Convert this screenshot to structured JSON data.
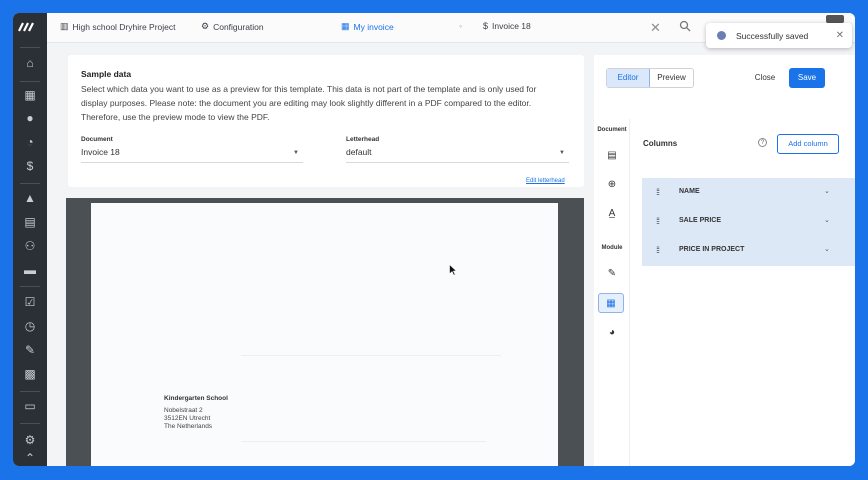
{
  "topbar": {
    "crumbs": [
      {
        "label": "High school Dryhire Project",
        "icon": "project-icon"
      },
      {
        "label": "Configuration",
        "icon": "gear-icon"
      },
      {
        "label": "My invoice",
        "icon": "template-icon"
      },
      {
        "label": "Invoice 18",
        "icon": "invoice-icon"
      }
    ]
  },
  "toast": {
    "message": "Successfully saved"
  },
  "sample": {
    "title": "Sample data",
    "description": "Select which data you want to use as a preview for this template. This data is not part of the template and is only used for display purposes. Please note: the document you are editing may look slightly different in a PDF compared to the editor. Therefore, use the preview mode to view the PDF.",
    "document_label": "Document",
    "document_value": "Invoice 18",
    "letterhead_label": "Letterhead",
    "letterhead_value": "default",
    "edit_letterhead": "Edit letterhead"
  },
  "paper": {
    "company": "Kindergarten School",
    "address_lines": [
      "Nobelstraat 2",
      "3512EN Utrecht",
      "The Netherlands"
    ]
  },
  "panel": {
    "tab_editor": "Editor",
    "tab_preview": "Preview",
    "close_label": "Close",
    "save_label": "Save",
    "document_label": "Document",
    "module_label": "Module",
    "columns_title": "Columns",
    "add_column_label": "Add column",
    "columns": [
      "NAME",
      "SALE PRICE",
      "PRICE IN PROJECT"
    ]
  },
  "colors": {
    "accent": "#1a73e8",
    "rail": "#2b2f36",
    "column_list_bg": "#dde8f7"
  }
}
